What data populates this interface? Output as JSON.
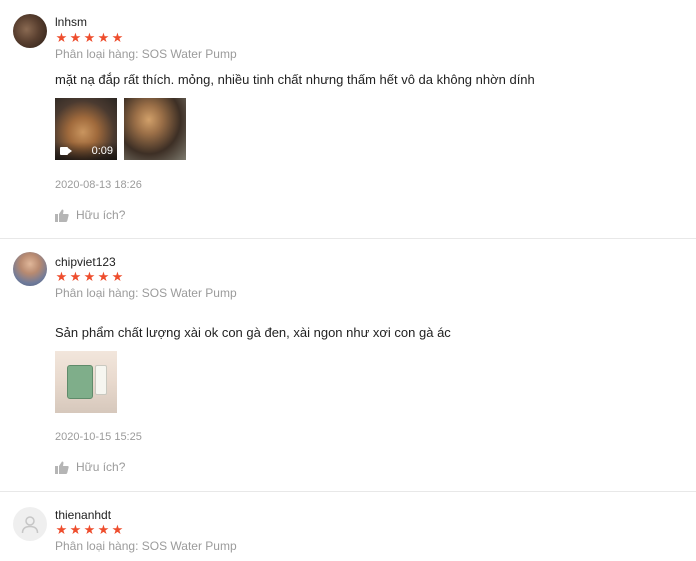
{
  "reviews": [
    {
      "username": "lnhsm",
      "rating": 5,
      "variation": "Phân loại hàng: SOS Water Pump",
      "comment": "mặt nạ đắp rất thích. mỏng, nhiều tinh chất nhưng thấm hết vô da không nhờn dính",
      "media": [
        {
          "type": "video",
          "duration": "0:09"
        },
        {
          "type": "image"
        }
      ],
      "timestamp": "2020-08-13 18:26",
      "helpful_label": "Hữu ích?"
    },
    {
      "username": "chipviet123",
      "rating": 5,
      "variation": "Phân loại hàng: SOS Water Pump",
      "comment": "Sản phẩm chất lượng xài ok con gà đen, xài ngon như xơi con gà ác",
      "media": [
        {
          "type": "image"
        }
      ],
      "timestamp": "2020-10-15 15:25",
      "helpful_label": "Hữu ích?"
    },
    {
      "username": "thienanhdt",
      "rating": 5,
      "variation": "Phân loại hàng: SOS Water Pump"
    }
  ],
  "colors": {
    "star": "#ee4d2d",
    "muted_text": "#9b9b9b",
    "divider": "#e8e8e8"
  },
  "icons": {
    "star": "star-icon",
    "helpful": "thumbs-up-icon",
    "video": "video-camera-icon",
    "default_avatar": "user-silhouette-icon"
  }
}
